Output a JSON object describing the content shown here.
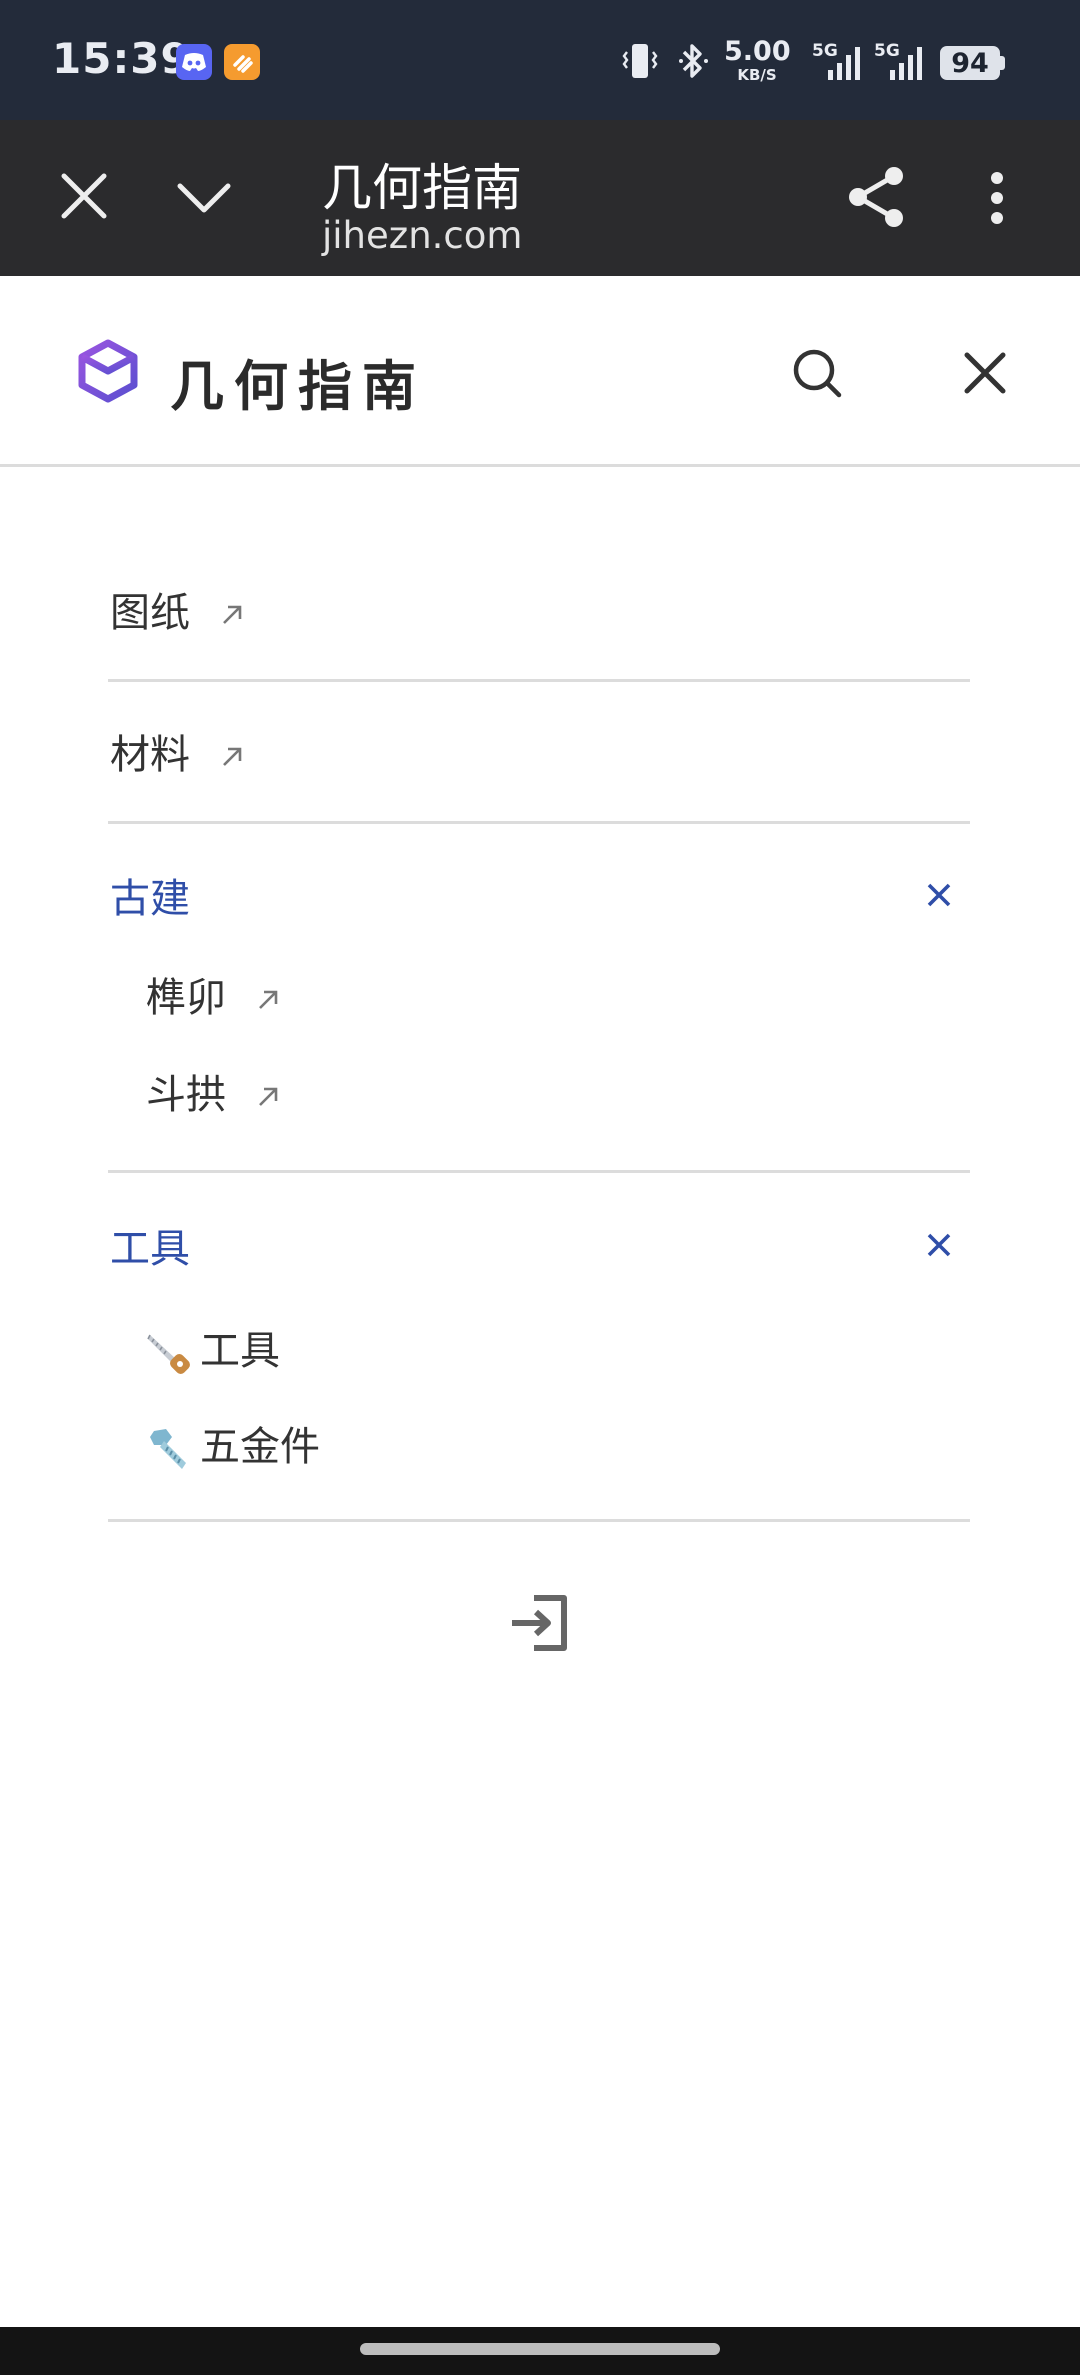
{
  "status_bar": {
    "time": "15:39",
    "net_speed_value": "5.00",
    "net_speed_unit": "KB/S",
    "signal1_label": "5G",
    "signal2_label": "5G",
    "battery": "94",
    "icons": [
      "discord-icon",
      "orange-app-icon",
      "vibrate-icon",
      "bluetooth-icon",
      "signal-icon",
      "battery-icon"
    ]
  },
  "browser": {
    "title": "几何指南",
    "url": "jihezn.com",
    "icons": [
      "close-icon",
      "chevron-down-icon",
      "share-icon",
      "more-vert-icon"
    ]
  },
  "site": {
    "name": "几何指南",
    "brand_color": "#7b4fd6",
    "icons": [
      "logo-cube-icon",
      "search-icon",
      "close-icon"
    ]
  },
  "menu": {
    "accent_color": "#2f4ea8",
    "items": [
      {
        "label": "图纸",
        "type": "link"
      },
      {
        "label": "材料",
        "type": "link"
      },
      {
        "label": "古建",
        "type": "group",
        "expanded": true,
        "children": [
          {
            "label": "榫卯",
            "type": "link"
          },
          {
            "label": "斗拱",
            "type": "link"
          }
        ]
      },
      {
        "label": "工具",
        "type": "group",
        "expanded": true,
        "children": [
          {
            "label": "工具",
            "icon": "saw-icon"
          },
          {
            "label": "五金件",
            "icon": "bolt-icon"
          }
        ]
      }
    ],
    "login_icon": "login-icon"
  }
}
